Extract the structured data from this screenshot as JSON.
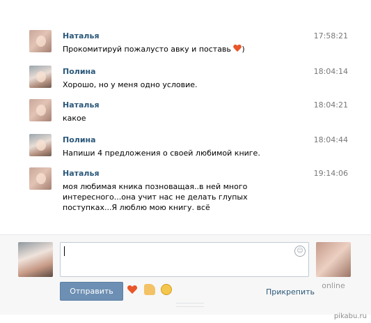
{
  "messages": [
    {
      "author": "Наталья",
      "time": "17:58:21",
      "text": "Прокомитируй пожалусто авку и поставь",
      "suffix": ")",
      "has_heart": true
    },
    {
      "author": "Полина",
      "time": "18:04:14",
      "text": "Хорошо, но у меня одно условие."
    },
    {
      "author": "Наталья",
      "time": "18:04:21",
      "text": "какое"
    },
    {
      "author": "Полина",
      "time": "18:04:44",
      "text": "Напиши 4 предложения о своей любимой книге."
    },
    {
      "author": "Наталья",
      "time": "19:14:06",
      "text": "моя любимая кника позноващая..в ней много интересного...она учит нас не делать глупых поступках...Я люблю мою книгу. всё"
    }
  ],
  "composer": {
    "input_value": "",
    "send_label": "Отправить",
    "attach_label": "Прикрепить",
    "peer_status": "online",
    "emoji": [
      "heart-icon",
      "thumbs-up-icon",
      "blush-icon"
    ]
  },
  "watermark": "pikabu.ru",
  "colors": {
    "author": "#2b587a",
    "send_button": "#6d8fb3",
    "heart": "#e8562a"
  }
}
